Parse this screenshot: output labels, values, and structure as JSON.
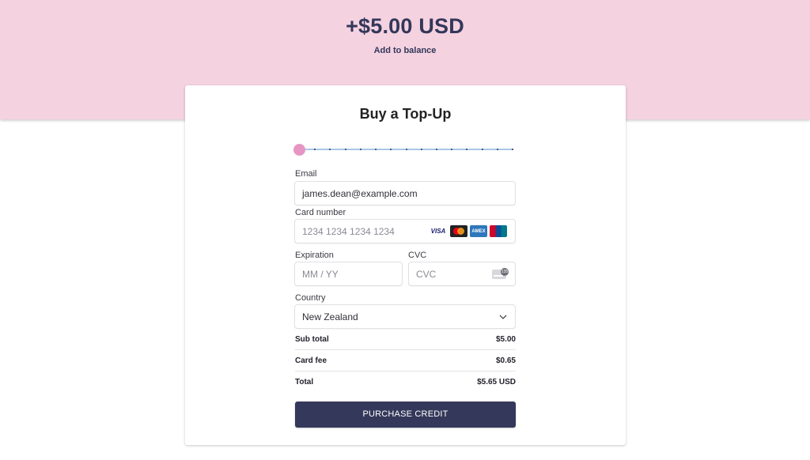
{
  "hero": {
    "amount": "+$5.00 USD",
    "subtitle": "Add to balance",
    "background": "#f4d2e0"
  },
  "card": {
    "title": "Buy a Top-Up"
  },
  "slider": {
    "step_count": 15,
    "selected_step": 0,
    "thumb_color": "#e795c2"
  },
  "form": {
    "email": {
      "label": "Email",
      "value": "james.dean@example.com"
    },
    "card_number": {
      "label": "Card number",
      "placeholder": "1234 1234 1234 1234",
      "brands": [
        "VISA",
        "mastercard",
        "AMEX",
        "UnionPay"
      ]
    },
    "expiration": {
      "label": "Expiration",
      "placeholder": "MM / YY"
    },
    "cvc": {
      "label": "CVC",
      "placeholder": "CVC",
      "icon": "cvc-card-icon",
      "icon_badge": "135"
    },
    "country": {
      "label": "Country",
      "value": "New Zealand",
      "icon": "chevron-down-icon"
    }
  },
  "summary": [
    {
      "label": "Sub total",
      "value": "$5.00"
    },
    {
      "label": "Card fee",
      "value": "$0.65"
    },
    {
      "label": "Total",
      "value": "$5.65 USD"
    }
  ],
  "purchase_button": {
    "label": "PURCHASE CREDIT",
    "color": "#34385a"
  }
}
